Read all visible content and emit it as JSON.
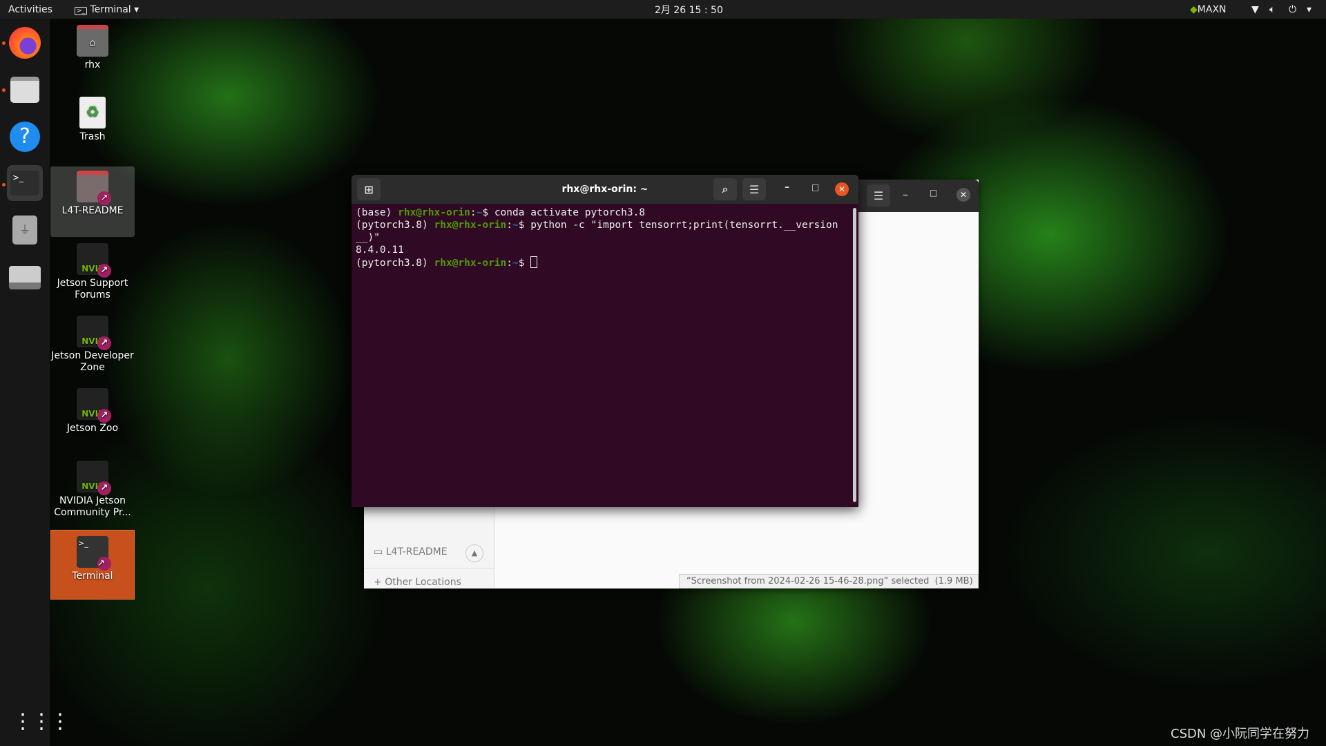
{
  "topbar": {
    "activities": "Activities",
    "app_menu": "Terminal",
    "clock": "2月 26 15 : 50",
    "power_mode": "MAXN"
  },
  "dock": {
    "items": [
      "firefox",
      "files",
      "help",
      "terminal",
      "usb-drive",
      "disk-drive"
    ],
    "apps_grid": "show-applications"
  },
  "desktop": {
    "icons": [
      {
        "label": "rhx"
      },
      {
        "label": "Trash"
      },
      {
        "label": "L4T-README"
      },
      {
        "label": "Jetson Support Forums"
      },
      {
        "label": "Jetson Developer Zone"
      },
      {
        "label": "Jetson Zoo"
      },
      {
        "label": "NVIDIA Jetson Community Pr..."
      },
      {
        "label": "Terminal"
      }
    ],
    "nvidia_logo_text": "NVIDIA"
  },
  "terminal": {
    "title": "rhx@rhx-orin: ~",
    "lines": [
      {
        "env": "(base) ",
        "user": "rhx@rhx-orin",
        "sep": ":",
        "path": "~",
        "prompt": "$ ",
        "cmd": "conda activate pytorch3.8"
      },
      {
        "env": "(pytorch3.8) ",
        "user": "rhx@rhx-orin",
        "sep": ":",
        "path": "~",
        "prompt": "$ ",
        "cmd": "python -c \"import tensorrt;print(tensorrt.__version"
      },
      {
        "text": "__)\""
      },
      {
        "text": "8.4.0.11"
      },
      {
        "env": "(pytorch3.8) ",
        "user": "rhx@rhx-orin",
        "sep": ":",
        "path": "~",
        "prompt": "$ "
      }
    ],
    "colors": {
      "background": "#300a24",
      "user": "#4e9a06",
      "path": "#3465a4"
    }
  },
  "file_manager": {
    "sidebar": [
      {
        "label": "L4T-README"
      },
      {
        "label": "Other Locations"
      }
    ],
    "status": "“Screenshot from 2024-02-26 15-46-28.png” selected  (1.9 MB)"
  },
  "watermark": "CSDN @小阮同学在努力"
}
